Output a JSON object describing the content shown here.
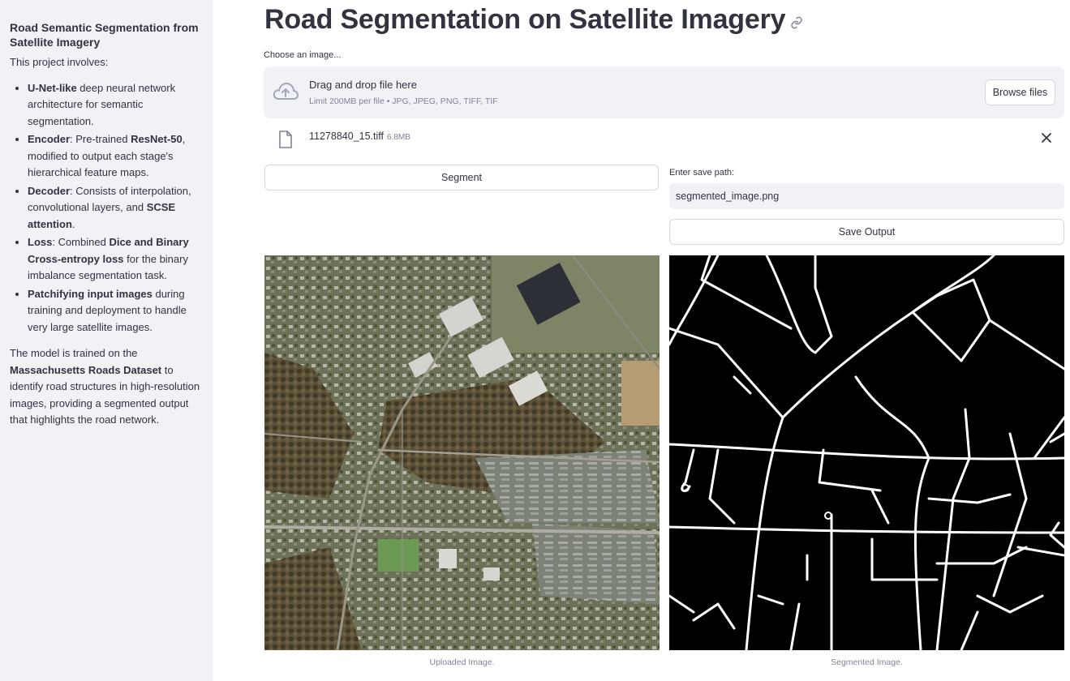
{
  "sidebar": {
    "title": "Road Semantic Segmentation from Satellite Imagery",
    "intro": "This project involves:",
    "bullets": [
      {
        "b1": "U-Net-like",
        "t1": " deep neural network architecture for semantic segmentation."
      },
      {
        "b1": "Encoder",
        "t1": ": Pre-trained ",
        "b2": "ResNet-50",
        "t2": ", modified to output each stage's hierarchical feature maps."
      },
      {
        "b1": "Decoder",
        "t1": ": Consists of interpolation, convolutional layers, and ",
        "b2": "SCSE attention",
        "t2": "."
      },
      {
        "b1": "Loss",
        "t1": ": Combined ",
        "b2": "Dice and Binary Cross-entropy loss",
        "t2": " for the binary imbalance segmentation task."
      },
      {
        "b1": "Patchifying input images",
        "t1": " during training and deployment to handle very large satellite images."
      }
    ],
    "outro_pre": "The model is trained on the ",
    "outro_bold": "Massachusetts Roads Dataset",
    "outro_post": " to identify road structures in high-resolution images, providing a segmented output that highlights the road network."
  },
  "main": {
    "title": "Road Segmentation on Satellite Imagery",
    "uploader_label": "Choose an image...",
    "drop_title": "Drag and drop file here",
    "drop_limit": "Limit 200MB per file • JPG, JPEG, PNG, TIFF, TIF",
    "browse_label": "Browse files",
    "file_name": "11278840_15.tiff",
    "file_size": "6.8MB",
    "segment_label": "Segment",
    "save_path_label": "Enter save path:",
    "save_path_value": "segmented_image.png",
    "save_output_label": "Save Output",
    "caption_uploaded": "Uploaded Image.",
    "caption_segmented": "Segmented Image."
  },
  "colors": {
    "sidebar_bg": "#f0f2f6",
    "text": "#31333f",
    "muted": "#808495",
    "mask_bg": "#000000",
    "mask_road": "#ffffff"
  },
  "icons": [
    "link-icon",
    "cloud-upload-icon",
    "file-icon",
    "close-icon"
  ]
}
